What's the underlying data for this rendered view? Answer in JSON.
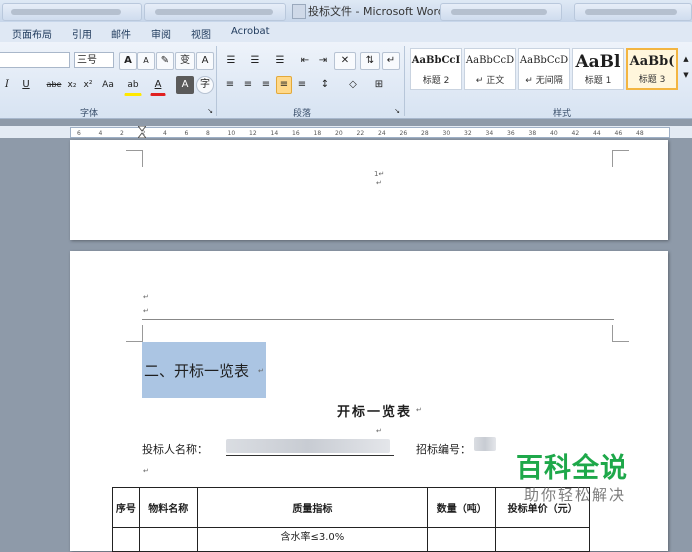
{
  "window": {
    "title": "投标文件 - Microsoft Word"
  },
  "menu": {
    "items": [
      "页面布局",
      "引用",
      "邮件",
      "审阅",
      "视图",
      "Acrobat"
    ]
  },
  "ribbon": {
    "font_size": "三号",
    "groups": {
      "font": "字体",
      "paragraph": "段落",
      "styles": "样式"
    },
    "font_buttons": {
      "grow": "A",
      "shrink": "A",
      "clear": "✎",
      "phonetic": "变",
      "border": "A",
      "underline": "U",
      "strike": "abe",
      "subscript": "x₂",
      "superscript": "x²",
      "case": "Aa",
      "highlight": "ab",
      "color": "A",
      "shade": "A",
      "enclose": "字"
    },
    "styles": [
      {
        "sample": "AaBbCcI",
        "name": "标题 2"
      },
      {
        "sample": "AaBbCcD",
        "name": "↵ 正文"
      },
      {
        "sample": "AaBbCcD",
        "name": "↵ 无间隔"
      },
      {
        "sample": "AaBl",
        "name": "标题 1"
      },
      {
        "sample": "AaBb(",
        "name": "标题 3"
      }
    ]
  },
  "ruler": {
    "numbers": [
      "6",
      "4",
      "2",
      "2",
      "4",
      "6",
      "8",
      "10",
      "12",
      "14",
      "16",
      "18",
      "20",
      "22",
      "24",
      "26",
      "28",
      "30",
      "32",
      "34",
      "36",
      "38",
      "40",
      "42",
      "44",
      "46",
      "48"
    ]
  },
  "page1": {
    "page_number": "1↵",
    "para": "↵"
  },
  "page2": {
    "heading": "二、开标一览表",
    "table_title": "开标一览表",
    "bidder_label": "投标人名称：",
    "bid_no_label": "招标编号：",
    "para": "↵"
  },
  "table": {
    "headers": [
      "序号",
      "物料名称",
      "质量指标",
      "数量（吨）",
      "投标单价（元）"
    ],
    "row1_quality": "含水率≤3.0%"
  },
  "watermark": {
    "title": "百科全说",
    "subtitle": "助你轻松解决"
  }
}
